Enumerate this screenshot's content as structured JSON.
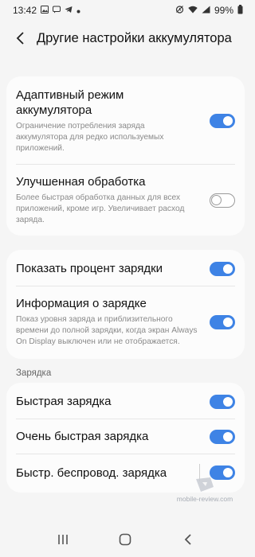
{
  "status": {
    "time": "13:42",
    "battery": "99%"
  },
  "header": {
    "title": "Другие настройки аккумулятора"
  },
  "group1": {
    "adaptive": {
      "label": "Адаптивный режим аккумулятора",
      "desc": "Ограничение потребления заряда аккумулятора для редко используемых приложений.",
      "on": true
    },
    "enhanced": {
      "label": "Улучшенная обработка",
      "desc": "Более быстрая обработка данных для всех приложений, кроме игр. Увеличивает расход заряда.",
      "on": false
    }
  },
  "group2": {
    "percent": {
      "label": "Показать процент зарядки",
      "on": true
    },
    "info": {
      "label": "Информация о зарядке",
      "desc": "Показ уровня заряда и приблизительного времени до полной зарядки, когда экран Always On Display выключен или не отображается.",
      "on": true
    }
  },
  "charging_section": {
    "title": "Зарядка"
  },
  "group3": {
    "fast": {
      "label": "Быстрая зарядка",
      "on": true
    },
    "super_fast": {
      "label": "Очень быстрая зарядка",
      "on": true
    },
    "wireless": {
      "label": "Быстр. беспровод. зарядка",
      "on": true
    }
  },
  "watermark": {
    "text": "mobile-review.com"
  },
  "colors": {
    "accent": "#3e83e5",
    "background": "#f5f5f5",
    "card": "#fcfcfc"
  },
  "icons": [
    "image-icon",
    "message-icon",
    "telegram-icon",
    "dot-icon",
    "alarm-icon",
    "wifi-icon",
    "signal-icon",
    "battery-icon",
    "back-arrow-icon",
    "recents-icon",
    "home-icon",
    "back-icon"
  ]
}
